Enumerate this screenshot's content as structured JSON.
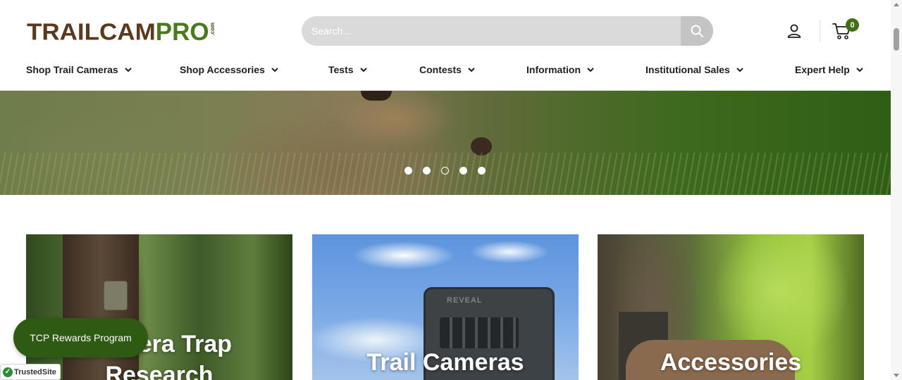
{
  "brand": {
    "logo_main": "TRAILCAM",
    "logo_accent": "PRO",
    "logo_suffix": ".com",
    "brown": "#5a3a1e",
    "green": "#4a7a1e"
  },
  "search": {
    "placeholder": "Search...",
    "button_icon": "search-icon"
  },
  "header_icons": {
    "account": "account-icon",
    "cart": "cart-icon",
    "cart_count": "0"
  },
  "nav": {
    "items": [
      {
        "label": "Shop Trail Cameras"
      },
      {
        "label": "Shop Accessories"
      },
      {
        "label": "Tests"
      },
      {
        "label": "Contests"
      },
      {
        "label": "Information"
      },
      {
        "label": "Institutional Sales"
      },
      {
        "label": "Expert Help"
      }
    ]
  },
  "hero": {
    "slides_total": 5,
    "active_slide": 3
  },
  "categories": [
    {
      "title_line1": "Camera Trap",
      "title_line2": "Research"
    },
    {
      "title": "Trail Cameras",
      "camera_brand": "REVEAL"
    },
    {
      "title": "Accessories"
    }
  ],
  "widgets": {
    "rewards_label": "TCP Rewards Program",
    "trusted_label": "TrustedSite",
    "rewards_color": "#2f5a14"
  }
}
